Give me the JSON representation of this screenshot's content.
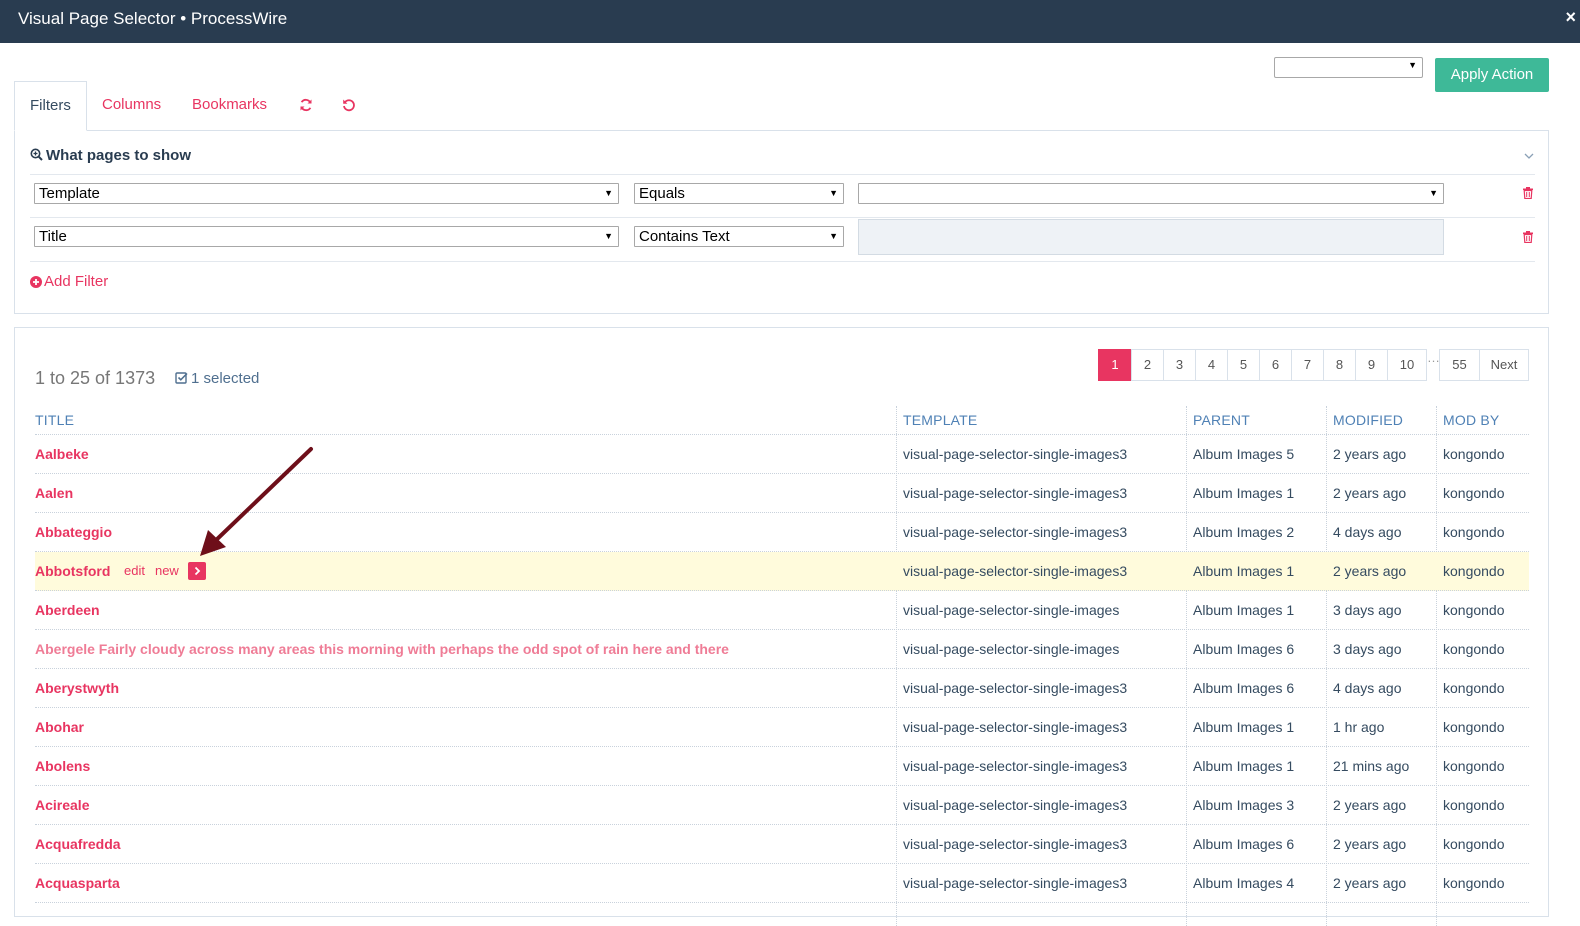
{
  "window": {
    "title": "Visual Page Selector • ProcessWire",
    "close_icon": "×"
  },
  "actions": {
    "select_value": "",
    "apply_label": "Apply Action"
  },
  "tabs": [
    {
      "label": "Filters"
    },
    {
      "label": "Columns"
    },
    {
      "label": "Bookmarks"
    }
  ],
  "filters": {
    "header": "What pages to show",
    "rows": [
      {
        "field": "Template",
        "operator": "Equals",
        "value": ""
      },
      {
        "field": "Title",
        "operator": "Contains Text",
        "value": ""
      }
    ],
    "add_label": "Add Filter"
  },
  "results": {
    "count_text": "1 to 25 of 1373",
    "selected_text": "1 selected",
    "pagination": [
      "1",
      "2",
      "3",
      "4",
      "5",
      "6",
      "7",
      "8",
      "9",
      "10",
      "55",
      "Next"
    ],
    "pagination_ellipsis": "…",
    "current_page": "1",
    "columns": [
      "TITLE",
      "TEMPLATE",
      "PARENT",
      "MODIFIED",
      "MOD BY"
    ],
    "row_actions": {
      "edit": "edit",
      "new": "new"
    },
    "rows": [
      {
        "title": "Aalbeke",
        "template": "visual-page-selector-single-images3",
        "parent": "Album Images 5",
        "modified": "2 years ago",
        "mod_by": "kongondo"
      },
      {
        "title": "Aalen",
        "template": "visual-page-selector-single-images3",
        "parent": "Album Images 1",
        "modified": "2 years ago",
        "mod_by": "kongondo"
      },
      {
        "title": "Abbateggio",
        "template": "visual-page-selector-single-images3",
        "parent": "Album Images 2",
        "modified": "4 days ago",
        "mod_by": "kongondo"
      },
      {
        "title": "Abbotsford",
        "template": "visual-page-selector-single-images3",
        "parent": "Album Images 1",
        "modified": "2 years ago",
        "mod_by": "kongondo"
      },
      {
        "title": "Aberdeen",
        "template": "visual-page-selector-single-images",
        "parent": "Album Images 1",
        "modified": "3 days ago",
        "mod_by": "kongondo"
      },
      {
        "title": "Abergele Fairly cloudy across many areas this morning with perhaps the odd spot of rain here and there",
        "template": "visual-page-selector-single-images",
        "parent": "Album Images 6",
        "modified": "3 days ago",
        "mod_by": "kongondo"
      },
      {
        "title": "Aberystwyth",
        "template": "visual-page-selector-single-images3",
        "parent": "Album Images 6",
        "modified": "4 days ago",
        "mod_by": "kongondo"
      },
      {
        "title": "Abohar",
        "template": "visual-page-selector-single-images3",
        "parent": "Album Images 1",
        "modified": "1 hr ago",
        "mod_by": "kongondo"
      },
      {
        "title": "Abolens",
        "template": "visual-page-selector-single-images3",
        "parent": "Album Images 1",
        "modified": "21 mins ago",
        "mod_by": "kongondo"
      },
      {
        "title": "Acireale",
        "template": "visual-page-selector-single-images3",
        "parent": "Album Images 3",
        "modified": "2 years ago",
        "mod_by": "kongondo"
      },
      {
        "title": "Acquafredda",
        "template": "visual-page-selector-single-images3",
        "parent": "Album Images 6",
        "modified": "2 years ago",
        "mod_by": "kongondo"
      },
      {
        "title": "Acquasparta",
        "template": "visual-page-selector-single-images3",
        "parent": "Album Images 4",
        "modified": "2 years ago",
        "mod_by": "kongondo"
      }
    ]
  },
  "colors": {
    "titlebar": "#293c50",
    "accent": "#e83561",
    "apply": "#3eb998",
    "highlight": "#fffbdc",
    "arrow": "#6e0f1a"
  },
  "icons": [
    "close-icon",
    "refresh-icon",
    "reset-icon",
    "search-plus-icon",
    "chevron-down-icon",
    "trash-icon",
    "plus-circle-icon",
    "check-square-icon",
    "chevron-right-icon",
    "arrow-annotation"
  ]
}
